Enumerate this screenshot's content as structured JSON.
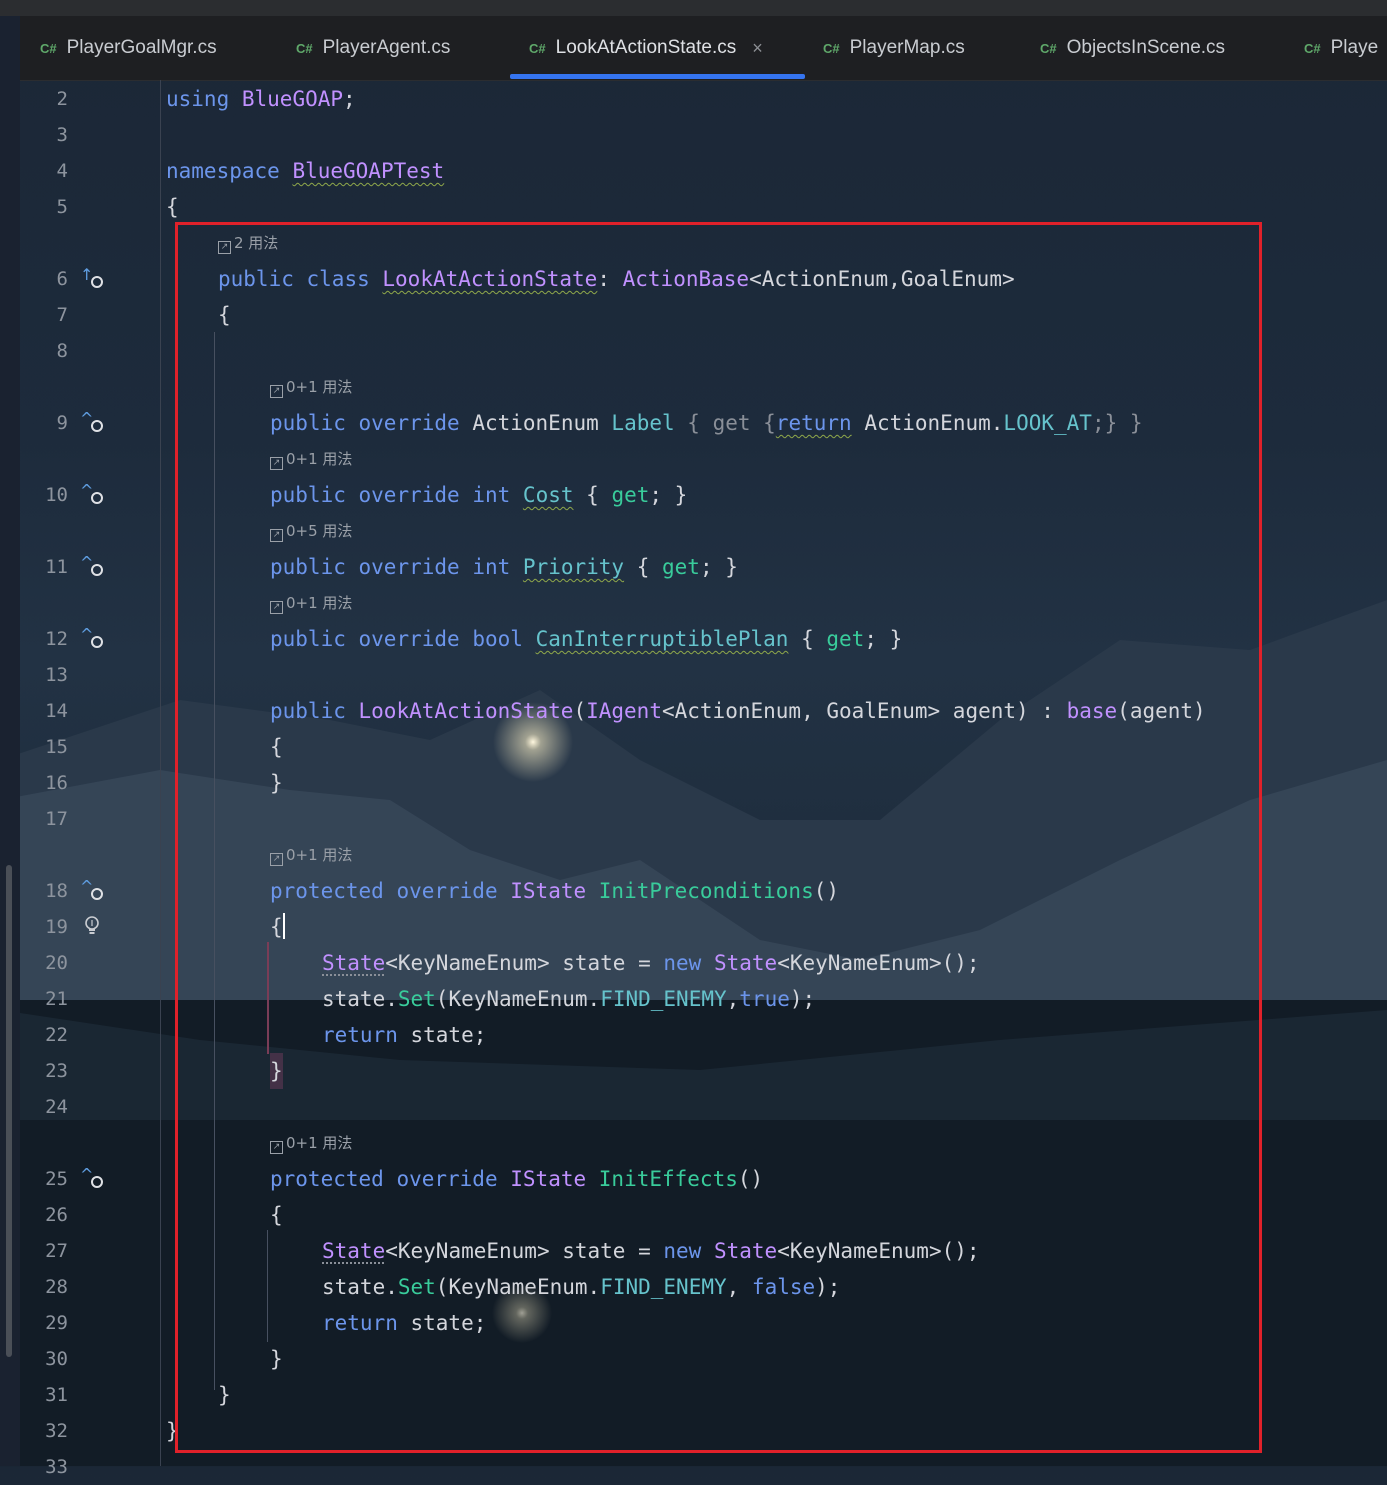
{
  "tabs": [
    {
      "lang": "C#",
      "label": "PlayerGoalMgr.cs"
    },
    {
      "lang": "C#",
      "label": "PlayerAgent.cs"
    },
    {
      "lang": "C#",
      "label": "LookAtActionState.cs",
      "close": "×"
    },
    {
      "lang": "C#",
      "label": "PlayerMap.cs"
    },
    {
      "lang": "C#",
      "label": "ObjectsInScene.cs"
    },
    {
      "lang": "C#",
      "label": "Playe"
    }
  ],
  "active_tab": "LookAtActionState.cs",
  "hints": {
    "h6": "2 用法",
    "h9": "0+1 用法",
    "h10": "0+1 用法",
    "h11": "0+5 用法",
    "h12": "0+1 用法",
    "h18": "0+1 用法",
    "h25": "0+1 用法"
  },
  "line_numbers": [
    "2",
    "3",
    "4",
    "5",
    "6",
    "7",
    "8",
    "9",
    "10",
    "11",
    "12",
    "13",
    "14",
    "15",
    "16",
    "17",
    "18",
    "19",
    "20",
    "21",
    "22",
    "23",
    "24",
    "25",
    "26",
    "27",
    "28",
    "29",
    "30",
    "31",
    "32",
    "33"
  ],
  "code": {
    "l2": [
      "using",
      " ",
      "BlueGOAP",
      ";"
    ],
    "l4": [
      "namespace",
      " ",
      "BlueGOAPTest"
    ],
    "l5": "{",
    "l6": [
      "public",
      " ",
      "class",
      " ",
      "LookAtActionState",
      ": ",
      "ActionBase",
      "<",
      "ActionEnum",
      ",",
      "GoalEnum",
      ">"
    ],
    "l7": "{",
    "l9": [
      "public",
      " ",
      "override",
      " ",
      "ActionEnum",
      " ",
      "Label",
      " { ",
      "get",
      " {",
      "return",
      " ",
      "ActionEnum",
      ".",
      "LOOK_AT",
      ";} }"
    ],
    "l10": [
      "public",
      " ",
      "override",
      " ",
      "int",
      " ",
      "Cost",
      " { ",
      "get",
      "; }"
    ],
    "l11": [
      "public",
      " ",
      "override",
      " ",
      "int",
      " ",
      "Priority",
      " { ",
      "get",
      "; }"
    ],
    "l12": [
      "public",
      " ",
      "override",
      " ",
      "bool",
      " ",
      "CanInterruptiblePlan",
      " { ",
      "get",
      "; }"
    ],
    "l14": [
      "public",
      " ",
      "LookAtActionState",
      "(",
      "IAgent",
      "<",
      "ActionEnum",
      ", ",
      "GoalEnum",
      "> agent) : ",
      "base",
      "(agent)"
    ],
    "l15": "{",
    "l16": "}",
    "l18": [
      "protected",
      " ",
      "override",
      " ",
      "IState",
      " ",
      "InitPreconditions",
      "()"
    ],
    "l19": "{",
    "l20": [
      "State",
      "<",
      "KeyNameEnum",
      "> state = ",
      "new",
      " ",
      "State",
      "<",
      "KeyNameEnum",
      ">();"
    ],
    "l21": [
      "state.",
      "Set",
      "(",
      "KeyNameEnum",
      ".",
      "FIND_ENEMY",
      ",",
      "true",
      ");"
    ],
    "l22": [
      "return",
      " state;"
    ],
    "l23": "}",
    "l25": [
      "protected",
      " ",
      "override",
      " ",
      "IState",
      " ",
      "InitEffects",
      "()"
    ],
    "l26": "{",
    "l27": [
      "State",
      "<",
      "KeyNameEnum",
      "> state = ",
      "new",
      " ",
      "State",
      "<",
      "KeyNameEnum",
      ">();"
    ],
    "l28": [
      "state.",
      "Set",
      "(",
      "KeyNameEnum",
      ".",
      "FIND_ENEMY",
      ", ",
      "false",
      ");"
    ],
    "l29": [
      "return",
      " state;"
    ],
    "l30": "}",
    "l31": "}",
    "l32": "}"
  },
  "colors": {
    "keyword": "#6c95eb",
    "type": "#c191ff",
    "method": "#39cc9b",
    "highlight_box": "#e0212a",
    "tab_underline": "#3574f0"
  }
}
